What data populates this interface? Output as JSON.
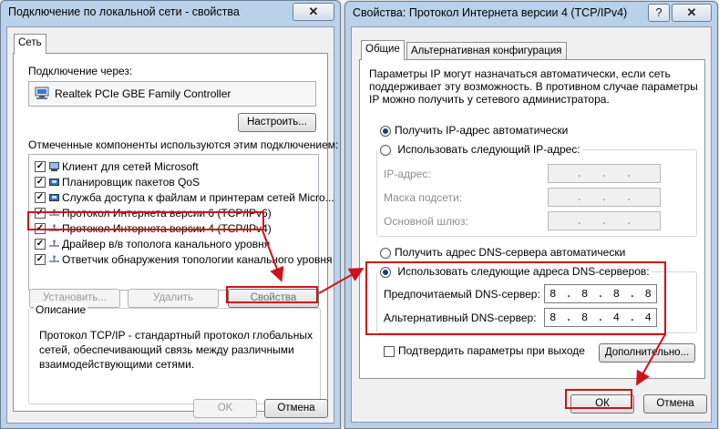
{
  "left_window": {
    "title": "Подключение по локальной сети - свойства",
    "close_glyph": "✕",
    "tab": "Сеть",
    "connect_via_label": "Подключение через:",
    "adapter_name": "Realtek PCIe GBE Family Controller",
    "configure_button": "Настроить...",
    "components_label": "Отмеченные компоненты используются этим подключением:",
    "components": [
      {
        "label": "Клиент для сетей Microsoft",
        "checked": true,
        "icon": "client-icon"
      },
      {
        "label": "Планировщик пакетов QoS",
        "checked": true,
        "icon": "service-icon"
      },
      {
        "label": "Служба доступа к файлам и принтерам сетей Micro...",
        "checked": true,
        "icon": "service-icon"
      },
      {
        "label": "Протокол Интернета версии 6 (TCP/IPv6)",
        "checked": true,
        "icon": "protocol-icon"
      },
      {
        "label": "Протокол Интернета версии 4 (TCP/IPv4)",
        "checked": true,
        "icon": "protocol-icon"
      },
      {
        "label": "Драйвер в/в тополога канального уровня",
        "checked": true,
        "icon": "protocol-icon"
      },
      {
        "label": "Ответчик обнаружения топологии канального уровня",
        "checked": true,
        "icon": "protocol-icon"
      }
    ],
    "install_button": "Установить...",
    "remove_button": "Удалить",
    "properties_button": "Свойства",
    "description_label": "Описание",
    "description_lines": [
      "Протокол TCP/IP - стандартный протокол глобальных",
      "сетей, обеспечивающий связь между различными",
      "взаимодействующими сетями."
    ],
    "ok_button": "OK",
    "cancel_button": "Отмена"
  },
  "right_window": {
    "title": "Свойства: Протокол Интернета версии 4 (TCP/IPv4)",
    "help_glyph": "?",
    "close_glyph": "✕",
    "tabs": [
      "Общие",
      "Альтернативная конфигурация"
    ],
    "intro_lines": [
      "Параметры IP могут назначаться автоматически, если сеть",
      "поддерживает эту возможность. В противном случае параметры",
      "IP можно получить у сетевого администратора."
    ],
    "ip_auto_label": "Получить IP-адрес автоматически",
    "ip_manual_label": "Использовать следующий IP-адрес:",
    "ip_address_label": "IP-адрес:",
    "subnet_label": "Маска подсети:",
    "gateway_label": "Основной шлюз:",
    "dns_auto_label": "Получить адрес DNS-сервера автоматически",
    "dns_manual_label": "Использовать следующие адреса DNS-серверов:",
    "preferred_dns_label": "Предпочитаемый DNS-сервер:",
    "preferred_dns": [
      "8",
      "8",
      "8",
      "8"
    ],
    "alternate_dns_label": "Альтернативный DNS-сервер:",
    "alternate_dns": [
      "8",
      "8",
      "4",
      "4"
    ],
    "validate_label": "Подтвердить параметры при выходе",
    "advanced_button": "Дополнительно...",
    "ok_button": "ОК",
    "cancel_button": "Отмена",
    "ip_mode": "auto",
    "dns_mode": "manual"
  },
  "highlight_color": "#d0111b"
}
